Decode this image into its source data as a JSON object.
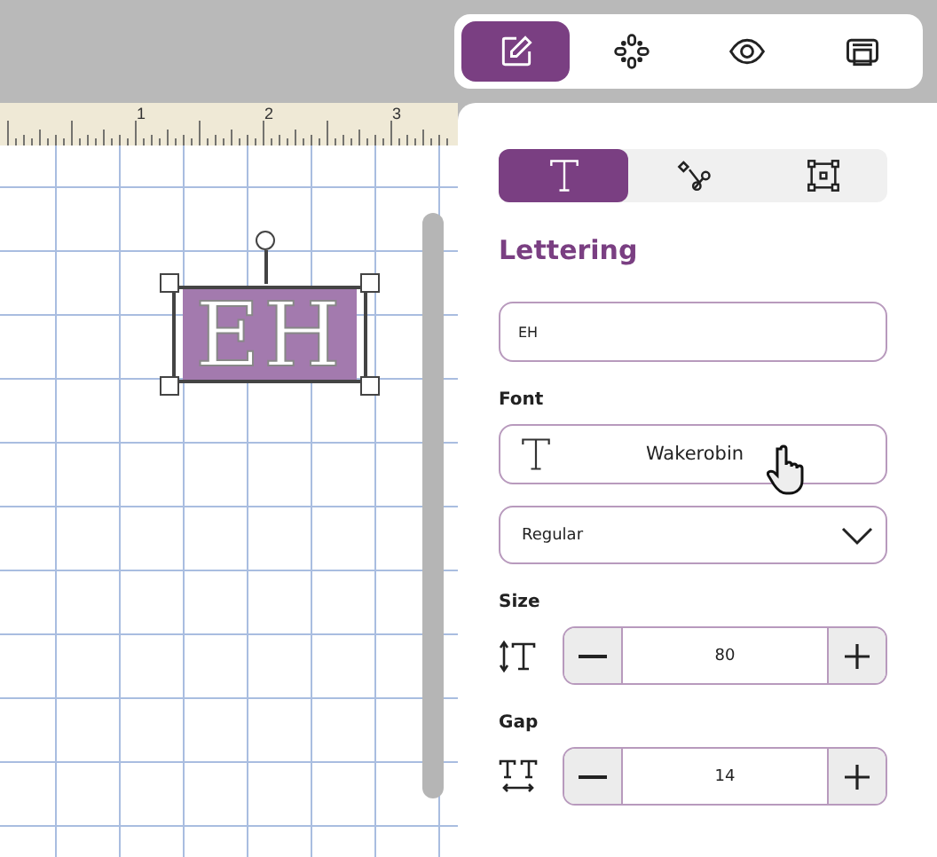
{
  "toolbar": [
    {
      "selected": true
    },
    {
      "selected": false
    },
    {
      "selected": false
    },
    {
      "selected": false
    }
  ],
  "canvas": {
    "ruler_labels": [
      "1",
      "2",
      "3"
    ],
    "lettering": "EH",
    "selected": true
  },
  "panel": {
    "tabs": [
      {
        "selected": true
      },
      {
        "selected": false
      },
      {
        "selected": false
      }
    ],
    "title": "Lettering",
    "text_input": {
      "value": "EH"
    },
    "font": {
      "label": "Font",
      "name": "Wakerobin"
    },
    "style": {
      "value": "Regular"
    },
    "size": {
      "label": "Size",
      "value": "80"
    },
    "gap": {
      "label": "Gap",
      "value": "14"
    }
  }
}
